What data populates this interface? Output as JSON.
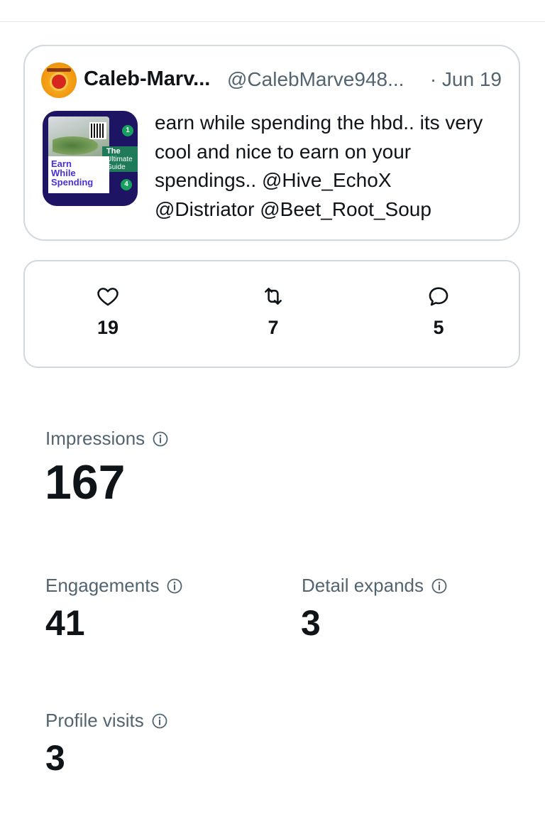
{
  "tweet": {
    "author_name": "Caleb-Marv...",
    "author_handle": "@CalebMarve948...",
    "date": "· Jun 19",
    "text": "earn while spending the hbd.. its very cool and nice to earn on your spendings.. @Hive_EchoX @Distriator @Beet_Root_Soup",
    "thumbnail": {
      "headline": [
        "Earn",
        "While",
        "Spending"
      ],
      "guide_label": [
        "The",
        "Ultimate",
        "Guide"
      ],
      "steps": [
        "1",
        "4"
      ]
    }
  },
  "engagement": {
    "likes": "19",
    "reposts": "7",
    "replies": "5"
  },
  "stats": {
    "impressions": {
      "label": "Impressions",
      "value": "167"
    },
    "engagements": {
      "label": "Engagements",
      "value": "41"
    },
    "detail_expands": {
      "label": "Detail expands",
      "value": "3"
    },
    "profile_visits": {
      "label": "Profile visits",
      "value": "3"
    }
  },
  "icons": {
    "like": "heart-icon",
    "repost": "repost-icon",
    "reply": "reply-icon",
    "info": "info-icon"
  },
  "colors": {
    "border": "#cfd9de",
    "secondary_text": "#536471",
    "primary_text": "#0f1419"
  }
}
